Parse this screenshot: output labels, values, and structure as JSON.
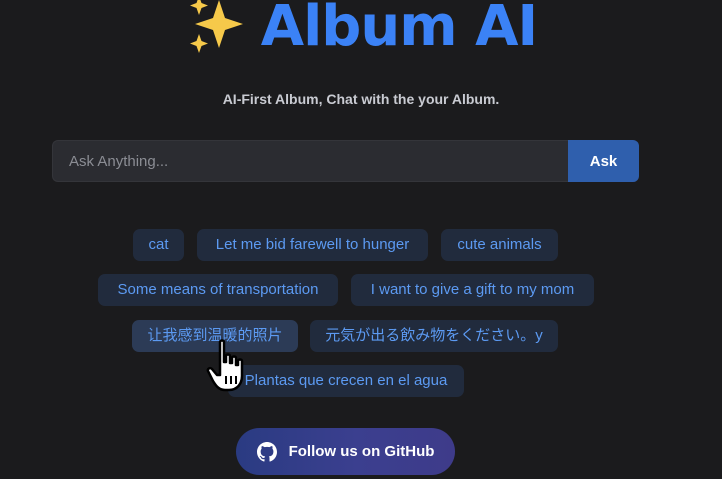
{
  "header": {
    "title": "Album AI",
    "sparkle_icon": "sparkles-icon",
    "subtitle": "AI-First Album, Chat with the your Album."
  },
  "search": {
    "placeholder": "Ask Anything...",
    "value": "",
    "button_label": "Ask"
  },
  "suggestions": [
    {
      "label": "cat"
    },
    {
      "label": "Let me bid farewell to hunger"
    },
    {
      "label": "cute animals"
    },
    {
      "label": "Some means of transportation"
    },
    {
      "label": "I want to give a gift to my mom"
    },
    {
      "label": "让我感到温暖的照片"
    },
    {
      "label": "元気が出る飲み物をください。y"
    },
    {
      "label": "Plantas que crecen en el agua"
    }
  ],
  "footer": {
    "github_label": "Follow us on GitHub",
    "github_icon": "github-icon"
  },
  "colors": {
    "background": "#1b1b1d",
    "accent": "#3b82f6",
    "chip_bg": "#212b3d",
    "chip_text": "#5c9af2",
    "ask_button": "#2f5fad"
  }
}
